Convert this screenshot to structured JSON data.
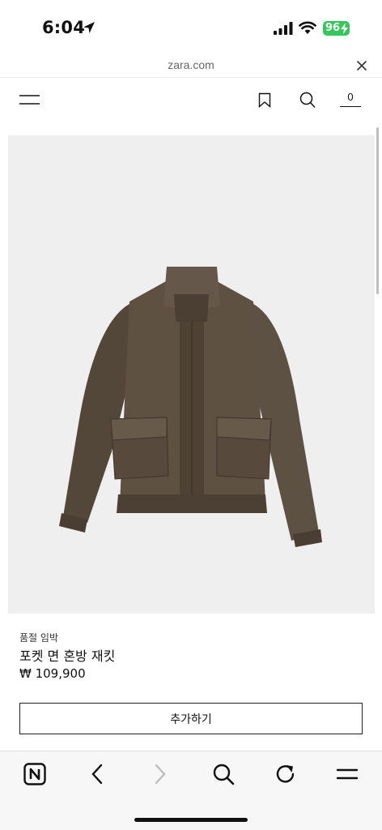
{
  "status": {
    "time": "6:04",
    "battery": "96"
  },
  "browser": {
    "url": "zara.com"
  },
  "header": {
    "cart_count": "0"
  },
  "product": {
    "tag": "품절 임박",
    "name": "포켓 면 혼방 재킷",
    "price": "₩ 109,900",
    "add_label": "추가하기"
  },
  "icons": {
    "location": "location-arrow-icon",
    "signal": "cellular-signal-icon",
    "wifi": "wifi-icon",
    "close": "close-icon",
    "menu": "menu-icon",
    "bookmark": "bookmark-icon",
    "search": "search-icon",
    "naver": "naver-n-icon",
    "back": "chevron-left-icon",
    "forward": "chevron-right-icon",
    "reload": "reload-icon",
    "more": "hamburger-icon"
  },
  "colors": {
    "battery": "#34c759",
    "image_bg": "#efefef",
    "jacket": "#5a4a3a"
  }
}
